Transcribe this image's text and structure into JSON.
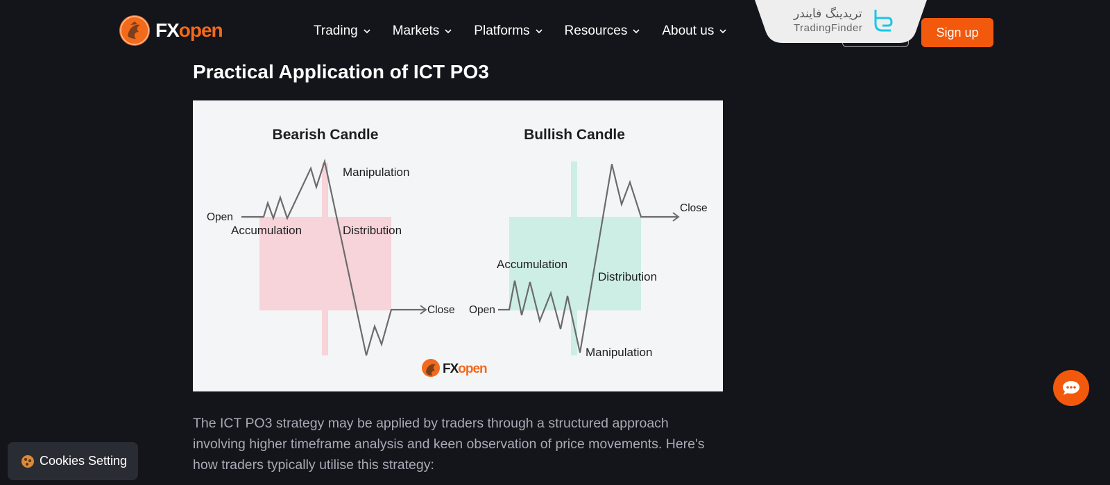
{
  "header": {
    "logo": {
      "fx": "FX",
      "open": "open"
    },
    "nav": [
      {
        "label": "Trading"
      },
      {
        "label": "Markets"
      },
      {
        "label": "Platforms"
      },
      {
        "label": "Resources"
      },
      {
        "label": "About us"
      }
    ],
    "signup_label": "Sign up",
    "tradingfinder": {
      "fa": "تریدینگ فایندر",
      "en": "TradingFinder"
    }
  },
  "article": {
    "heading": "Practical Application of ICT PO3",
    "figure": {
      "bearish_title": "Bearish Candle",
      "bullish_title": "Bullish Candle",
      "bearish_labels": {
        "open": "Open",
        "accumulation": "Accumulation",
        "manipulation": "Manipulation",
        "distribution": "Distribution",
        "close": "Close"
      },
      "bullish_labels": {
        "open": "Open",
        "accumulation": "Accumulation",
        "manipulation": "Manipulation",
        "distribution": "Distribution",
        "close": "Close"
      },
      "watermark": {
        "fx": "FX",
        "open": "open"
      },
      "colors": {
        "bearish": "#f7d3da",
        "bullish": "#cdeee4",
        "line": "#6b6b6b"
      }
    },
    "paragraph": "The ICT PO3 strategy may be applied by traders through a structured approach involving higher timeframe analysis and keen observation of price movements. Here's how traders typically utilise this strategy:"
  },
  "cookie": {
    "label": "Cookies Setting"
  },
  "colors": {
    "accent": "#f2590c",
    "background": "#14151a"
  }
}
